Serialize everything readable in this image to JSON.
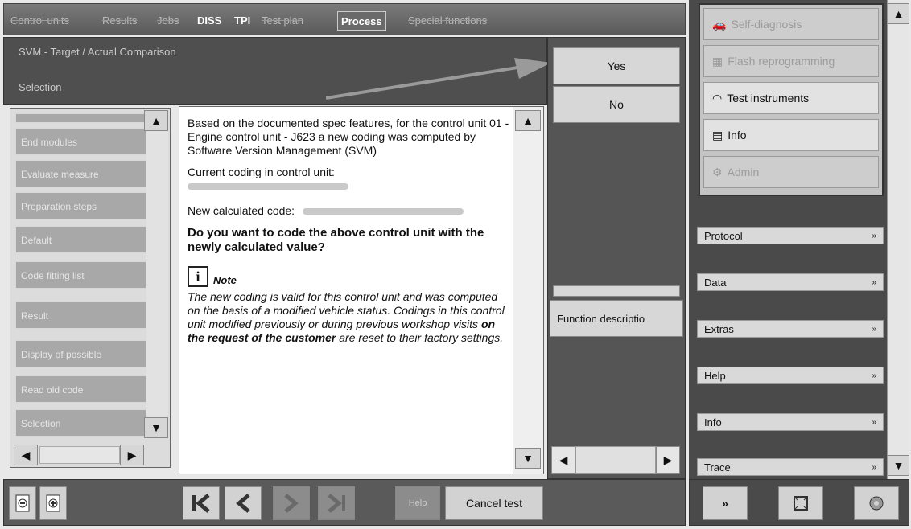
{
  "tabs": [
    {
      "label": "Control units",
      "state": "faded"
    },
    {
      "label": "Results",
      "state": "faded"
    },
    {
      "label": "Jobs",
      "state": "faded"
    },
    {
      "label": "DISS",
      "state": "normal"
    },
    {
      "label": "TPI",
      "state": "normal"
    },
    {
      "label": "Test plan",
      "state": "faded"
    },
    {
      "label": "Process",
      "state": "active"
    },
    {
      "label": "Special functions",
      "state": "faded"
    }
  ],
  "header": {
    "title": "SVM - Target / Actual Comparison",
    "subtitle": "Selection"
  },
  "nav": {
    "items": [
      "End modules",
      "Evaluate measure",
      "Preparation steps",
      "Default",
      "Code fitting list",
      "Result",
      "Display of possible",
      "Read old code",
      "Selection"
    ]
  },
  "dialog": {
    "para1": "Based on the documented spec features, for the control unit 01 - Engine control unit - J623 a new coding was computed by Software Version Management (SVM)",
    "current_label": "Current coding in control unit:",
    "new_label": "New calculated code:",
    "question": "Do you want to code the above control unit with the newly calculated value?",
    "note_label": "Note",
    "note_text_1": "The new coding is valid for this control unit and was computed on the basis of a modified vehicle status. Codings in this control unit modified previously or during previous workshop visits ",
    "note_text_bold": "on the request of the customer",
    "note_text_2": " are reset to their factory settings."
  },
  "actions": {
    "yes": "Yes",
    "no": "No",
    "function_description": "Function descriptio"
  },
  "toolbar": {
    "help": "Help",
    "cancel_test": "Cancel test"
  },
  "right_menu": [
    {
      "label": "Self-diagnosis",
      "state": "dim",
      "icon": "car-icon"
    },
    {
      "label": "Flash reprogramming",
      "state": "dim",
      "icon": "chip-icon"
    },
    {
      "label": "Test instruments",
      "state": "normal",
      "icon": "instrument-icon"
    },
    {
      "label": "Info",
      "state": "normal",
      "icon": "book-icon"
    },
    {
      "label": "Admin",
      "state": "dim",
      "icon": "admin-icon"
    }
  ],
  "right_sections": [
    "Protocol",
    "Data",
    "Extras",
    "Help",
    "Info",
    "Trace"
  ],
  "colors": {
    "panel_dark": "#4f4f4f",
    "button_light": "#d7d7d7",
    "arrow": "#8a8a8a"
  }
}
